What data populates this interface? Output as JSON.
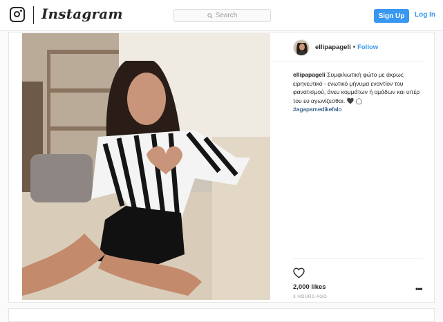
{
  "header": {
    "wordmark": "Instagram",
    "search_placeholder": "Search",
    "signup_label": "Sign Up",
    "login_label": "Log In",
    "accent_color": "#3897f0"
  },
  "post": {
    "username": "ellipapageli",
    "separator": "•",
    "follow_label": "Follow",
    "caption_username": "ellipapageli",
    "caption_text": "Συμφιλιωτική φώτο με άκρως ειρηνευτικό - ενωτικό μήνυμα εναντίον του φανατισμού, άνευ κομμάτων ή ομάδων και υπέρ του ευ αγωνίζεσθαι. 🖤 ◯",
    "hashtag": "#agapamedikefalo",
    "likes": "2,000 likes",
    "time": "3 HOURS AGO",
    "more_glyph": "•••"
  },
  "icons": {
    "logo": "instagram-logo-icon",
    "search": "search-icon",
    "heart": "heart-icon",
    "more": "more-options-icon"
  }
}
